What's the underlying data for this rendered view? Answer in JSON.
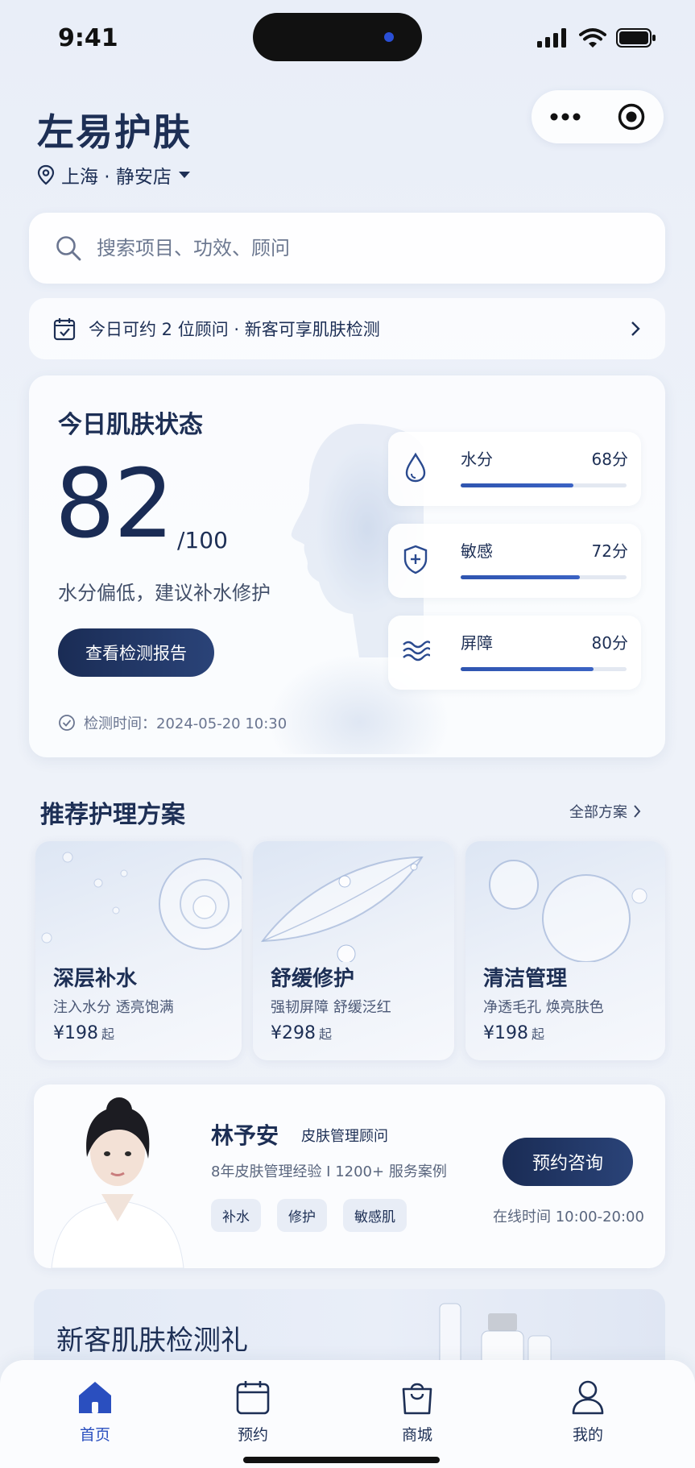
{
  "status": {
    "time": "9:41"
  },
  "header": {
    "brand": "左易护肤",
    "store": "上海 · 静安店"
  },
  "search": {
    "placeholder": "搜索项目、功效、顾问"
  },
  "notice": {
    "text": "今日可约 2 位顾问 · 新客可享肌肤检测"
  },
  "skin": {
    "title": "今日肌肤状态",
    "score": "82",
    "max": "/100",
    "advice": "水分偏低，建议补水修护",
    "report_button": "查看检测报告",
    "check_time": "检测时间：2024-05-20 10:30",
    "metrics": [
      {
        "name": "水分",
        "value": "68分",
        "level": 0.68,
        "icon": "water-drop-icon"
      },
      {
        "name": "敏感",
        "value": "72分",
        "level": 0.72,
        "icon": "shield-plus-icon"
      },
      {
        "name": "屏障",
        "value": "80分",
        "level": 0.8,
        "icon": "waves-icon"
      }
    ]
  },
  "plans": {
    "title": "推荐护理方案",
    "more": "全部方案",
    "items": [
      {
        "name": "深层补水",
        "desc": "注入水分  透亮饱满",
        "price": "¥198",
        "suffix": "起"
      },
      {
        "name": "舒缓修护",
        "desc": "强韧屏障  舒缓泛红",
        "price": "¥298",
        "suffix": "起"
      },
      {
        "name": "清洁管理",
        "desc": "净透毛孔  焕亮肤色",
        "price": "¥198",
        "suffix": "起"
      }
    ]
  },
  "advisor": {
    "name": "林予安",
    "role": "皮肤管理顾问",
    "meta": "8年皮肤管理经验  I  1200+ 服务案例",
    "tags": [
      "补水",
      "修护",
      "敏感肌"
    ],
    "button": "预约咨询",
    "online": "在线时间 10:00-20:00"
  },
  "promo": {
    "title": "新客肌肤检测礼"
  },
  "tabbar": [
    {
      "label": "首页",
      "icon": "home-icon",
      "active": true
    },
    {
      "label": "预约",
      "icon": "calendar-icon",
      "active": false
    },
    {
      "label": "商城",
      "icon": "shopping-bag-icon",
      "active": false
    },
    {
      "label": "我的",
      "icon": "user-icon",
      "active": false
    }
  ],
  "colors": {
    "primary": "#1a2c55",
    "accent": "#2a4fbf",
    "background": "#eef2f9"
  }
}
